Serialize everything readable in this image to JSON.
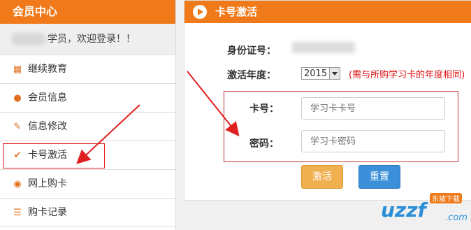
{
  "sidebar": {
    "title": "会员中心",
    "welcome": "学员，欢迎登录！！",
    "items": [
      {
        "label": "继续教育",
        "icon": "film-icon"
      },
      {
        "label": "会员信息",
        "icon": "user-icon"
      },
      {
        "label": "信息修改",
        "icon": "edit-icon"
      },
      {
        "label": "卡号激活",
        "icon": "check-icon"
      },
      {
        "label": "网上购卡",
        "icon": "globe-icon"
      },
      {
        "label": "购卡记录",
        "icon": "list-icon"
      }
    ]
  },
  "panel": {
    "title": "卡号激活",
    "id_label": "身份证号：",
    "year_label": "激活年度：",
    "year_value": "2015",
    "year_note": "(需与所购学习卡的年度相同)",
    "card_label": "卡号：",
    "card_placeholder": "学习卡卡号",
    "password_label": "密码：",
    "password_placeholder": "学习卡密码",
    "activate_label": "激活",
    "reset_label": "重置"
  },
  "colors": {
    "brand_orange": "#f07a1a",
    "activate_btn": "#f0b050",
    "reset_btn": "#3a8fd8",
    "annotation_red": "#e02020"
  },
  "watermark": {
    "text": "uzzf",
    "suffix": ".com",
    "tag": "东坡下载"
  }
}
